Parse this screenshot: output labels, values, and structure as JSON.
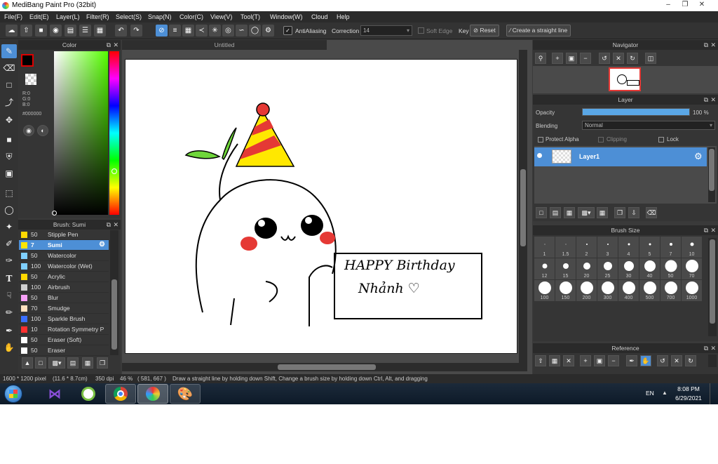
{
  "title": "MediBang Paint Pro (32bit)",
  "menu": [
    "File(F)",
    "Edit(E)",
    "Layer(L)",
    "Filter(R)",
    "Select(S)",
    "Snap(N)",
    "Color(C)",
    "View(V)",
    "Tool(T)",
    "Window(W)",
    "Cloud",
    "Help"
  ],
  "toolbar": {
    "antialiasing": "AntiAliasing",
    "correction_label": "Correction",
    "correction_value": "14",
    "soft_edge": "Soft Edge",
    "key": "Key",
    "reset": "Reset",
    "create_line": "Create a straight line"
  },
  "color_panel": {
    "title": "Color",
    "r": "R:0",
    "g": "G:0",
    "b": "B:0",
    "hex": "#000000"
  },
  "canvas": {
    "tab": "Untitled"
  },
  "brush_panel": {
    "title": "Brush: Sumi",
    "items": [
      {
        "size": "50",
        "name": "Stipple Pen",
        "color": "#ffd800"
      },
      {
        "size": "7",
        "name": "Sumi",
        "color": "#ffe600"
      },
      {
        "size": "50",
        "name": "Watercolor",
        "color": "#7fd0ff"
      },
      {
        "size": "100",
        "name": "Watercolor (Wet)",
        "color": "#7fd0ff"
      },
      {
        "size": "50",
        "name": "Acrylic",
        "color": "#ffd800"
      },
      {
        "size": "100",
        "name": "Airbrush",
        "color": "#cfcfcf"
      },
      {
        "size": "50",
        "name": "Blur",
        "color": "#f7a0f7"
      },
      {
        "size": "70",
        "name": "Smudge",
        "color": "#ffe0c0"
      },
      {
        "size": "100",
        "name": "Sparkle Brush",
        "color": "#3b6fff"
      },
      {
        "size": "10",
        "name": "Rotation Symmetry P",
        "color": "#ff3030"
      },
      {
        "size": "50",
        "name": "Eraser (Soft)",
        "color": "#ffffff"
      },
      {
        "size": "50",
        "name": "Eraser",
        "color": "#ffffff"
      }
    ]
  },
  "navigator": {
    "title": "Navigator"
  },
  "layer_panel": {
    "title": "Layer",
    "opacity_label": "Opacity",
    "opacity_value": "100 %",
    "opacity": 1.0,
    "blending_label": "Blending",
    "blending_value": "Normal",
    "protect_alpha": "Protect Alpha",
    "clipping": "Clipping",
    "lock": "Lock",
    "layer_name": "Layer1"
  },
  "brush_size": {
    "title": "Brush Size",
    "sizes": [
      "1",
      "1.5",
      "2",
      "3",
      "4",
      "5",
      "7",
      "10",
      "12",
      "15",
      "20",
      "25",
      "30",
      "40",
      "50",
      "70",
      "100",
      "150",
      "200",
      "300",
      "400",
      "500",
      "700",
      "1000"
    ]
  },
  "reference": {
    "title": "Reference"
  },
  "status": {
    "dims": "1600 * 1200 pixel",
    "cm": "(11.6 * 8.7cm)",
    "dpi": "350 dpi",
    "zoom": "46 %",
    "coords": "( 581, 667 )",
    "hint": "Draw a straight line by holding down Shift, Change a brush size by holding down Ctrl, Alt, and dragging"
  },
  "drawing": {
    "line1": "HAPPY Birthday",
    "line2": "Nhảnh ♡"
  },
  "taskbar": {
    "lang": "EN",
    "time": "8:08 PM",
    "date": "6/29/2021"
  },
  "colors": {
    "accent": "#4d8fd6",
    "panel": "#353535",
    "header": "#2a2a2a"
  }
}
